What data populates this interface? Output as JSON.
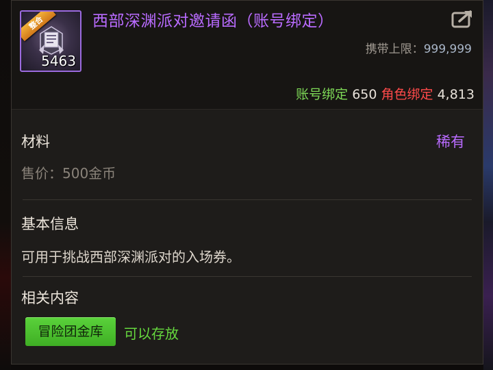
{
  "item": {
    "title": "西部深渊派对邀请函（账号绑定）",
    "badge": "整合",
    "count": "5463",
    "carry_limit_label": "携带上限：",
    "carry_limit_value": "999,999"
  },
  "binding": {
    "account_label": "账号绑定",
    "account_value": "650",
    "role_label": "角色绑定",
    "role_value": "4,813"
  },
  "material": {
    "category": "材料",
    "rarity": "稀有",
    "price": "售价：500金币"
  },
  "basic_info": {
    "title": "基本信息",
    "description": "可用于挑战西部深渊派对的入场券。"
  },
  "related": {
    "title": "相关内容",
    "storage_button": "冒险团金库",
    "storage_status": "可以存放"
  },
  "colors": {
    "rarity_purple": "#b96bff",
    "account_green": "#7ed957",
    "role_red": "#ff4a4a",
    "button_green": "#4fc22f"
  },
  "icons": [
    "share-icon",
    "item-icon"
  ]
}
